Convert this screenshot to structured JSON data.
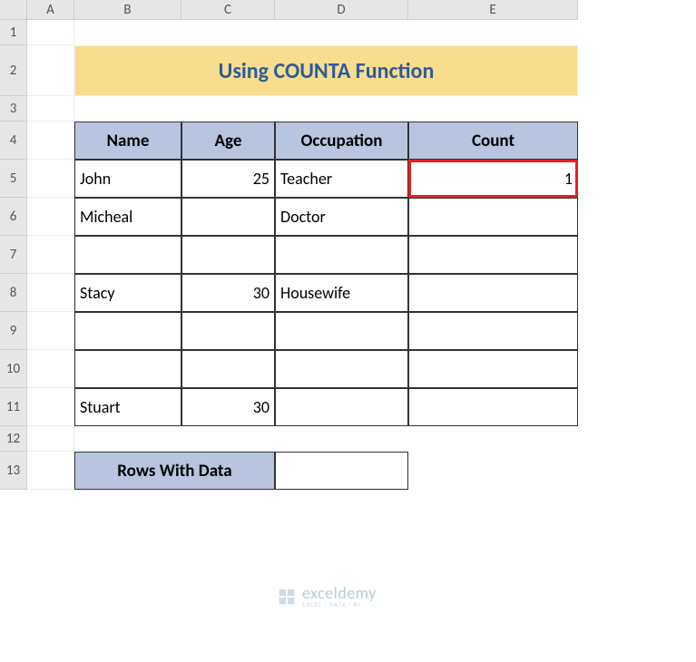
{
  "columns": [
    "A",
    "B",
    "C",
    "D",
    "E"
  ],
  "rows": [
    "1",
    "2",
    "3",
    "4",
    "5",
    "6",
    "7",
    "8",
    "9",
    "10",
    "11",
    "12",
    "13"
  ],
  "title": "Using COUNTA Function",
  "headers": {
    "name": "Name",
    "age": "Age",
    "occupation": "Occupation",
    "count": "Count"
  },
  "data": [
    {
      "name": "John",
      "age": "25",
      "occupation": "Teacher",
      "count": "1"
    },
    {
      "name": "Micheal",
      "age": "",
      "occupation": "Doctor",
      "count": ""
    },
    {
      "name": "",
      "age": "",
      "occupation": "",
      "count": ""
    },
    {
      "name": "Stacy",
      "age": "30",
      "occupation": "Housewife",
      "count": ""
    },
    {
      "name": "",
      "age": "",
      "occupation": "",
      "count": ""
    },
    {
      "name": "",
      "age": "",
      "occupation": "",
      "count": ""
    },
    {
      "name": "Stuart",
      "age": "30",
      "occupation": "",
      "count": ""
    }
  ],
  "summary": {
    "label": "Rows With Data",
    "value": ""
  },
  "watermark": {
    "main": "exceldemy",
    "sub": "EXCEL · DATA · BI"
  },
  "chart_data": {
    "type": "table",
    "title": "Using COUNTA Function",
    "columns": [
      "Name",
      "Age",
      "Occupation",
      "Count"
    ],
    "rows": [
      [
        "John",
        25,
        "Teacher",
        1
      ],
      [
        "Micheal",
        null,
        "Doctor",
        null
      ],
      [
        null,
        null,
        null,
        null
      ],
      [
        "Stacy",
        30,
        "Housewife",
        null
      ],
      [
        null,
        null,
        null,
        null
      ],
      [
        null,
        null,
        null,
        null
      ],
      [
        "Stuart",
        30,
        null,
        null
      ]
    ],
    "summary_label": "Rows With Data",
    "summary_value": null
  }
}
